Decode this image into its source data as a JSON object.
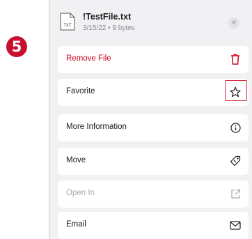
{
  "step_badge": "❺",
  "file": {
    "icon_text": "TXT",
    "name": "!TestFile.txt",
    "meta": "3/15/22 • 9 bytes"
  },
  "close_glyph": "×",
  "actions": [
    {
      "label": "Remove File",
      "icon": "trash-icon",
      "style": "danger"
    },
    {
      "label": "Favorite",
      "icon": "star-outline-icon",
      "style": "normal",
      "highlighted": true
    },
    {
      "label": "More Information",
      "icon": "info-icon",
      "style": "normal"
    },
    {
      "label": "Move",
      "icon": "tag-icon",
      "style": "normal"
    },
    {
      "label": "Open In",
      "icon": "open-external-icon",
      "style": "disabled"
    },
    {
      "label": "Email",
      "icon": "mail-icon",
      "style": "normal"
    }
  ],
  "colors": {
    "danger": "#d0021b",
    "highlight_box": "#d42a3f",
    "badge": "#c8102e"
  }
}
